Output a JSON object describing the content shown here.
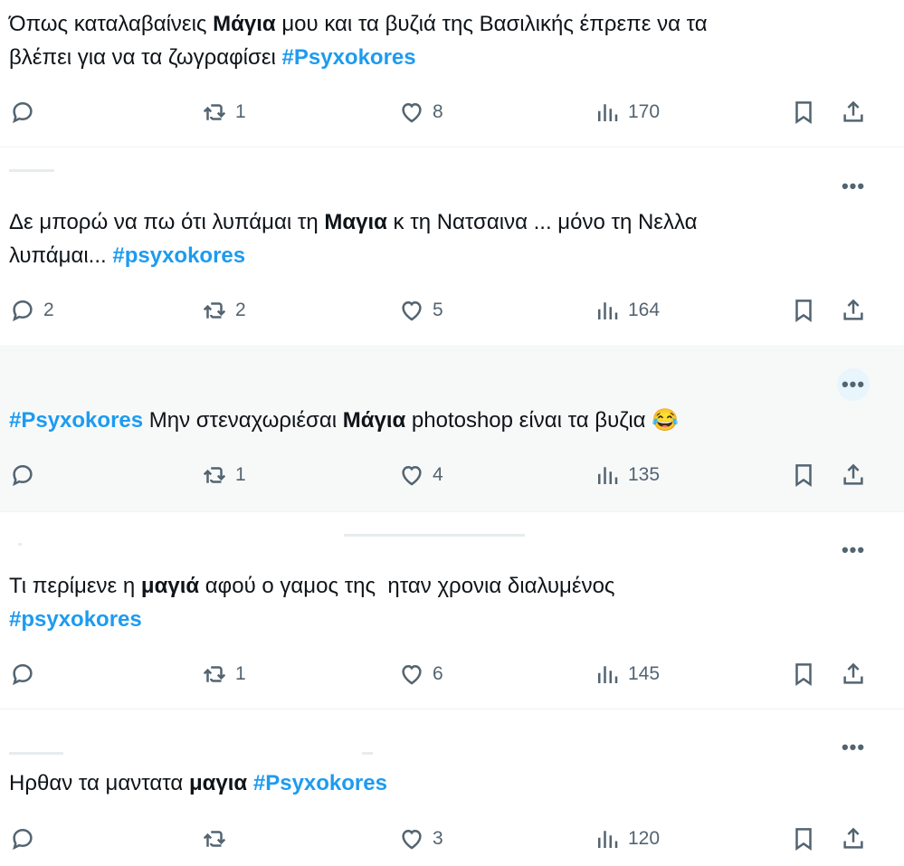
{
  "tweets": [
    {
      "text": [
        {
          "t": "Όπως καταλαβαίνεις ",
          "s": "n"
        },
        {
          "t": "Μάγια",
          "s": "b"
        },
        {
          "t": " μου και τα βυζιά της Βασιλικής έπρεπε να τα\nβλέπει για να τα ζωγραφίσει ",
          "s": "n"
        },
        {
          "t": "#Psyxokores",
          "s": "tag"
        }
      ],
      "replies": "",
      "retweets": "1",
      "likes": "8",
      "views": "170"
    },
    {
      "text": [
        {
          "t": "Δε μπορώ να πω ότι λυπάμαι τη ",
          "s": "n"
        },
        {
          "t": "Μαγια",
          "s": "b"
        },
        {
          "t": " κ τη Νατσαινα ... μόνο τη Νελλα\nλυπάμαι... ",
          "s": "n"
        },
        {
          "t": "#psyxokores",
          "s": "tag"
        }
      ],
      "replies": "2",
      "retweets": "2",
      "likes": "5",
      "views": "164"
    },
    {
      "text": [
        {
          "t": "#Psyxokores",
          "s": "tag"
        },
        {
          "t": " Μην στεναχωριέσαι ",
          "s": "n"
        },
        {
          "t": "Μάγια",
          "s": "b"
        },
        {
          "t": " photoshop είναι τα βυζια 😂",
          "s": "n"
        }
      ],
      "replies": "",
      "retweets": "1",
      "likes": "4",
      "views": "135"
    },
    {
      "text": [
        {
          "t": "Τι περίμενε η ",
          "s": "n"
        },
        {
          "t": "μαγιά",
          "s": "b"
        },
        {
          "t": " αφού ο γαμος της  ηταν χρονια διαλυμένος\n",
          "s": "n"
        },
        {
          "t": "#psyxokores",
          "s": "tag"
        }
      ],
      "replies": "",
      "retweets": "1",
      "likes": "6",
      "views": "145"
    },
    {
      "text": [
        {
          "t": "Ηρθαν τα μαντατα ",
          "s": "n"
        },
        {
          "t": "μαγια",
          "s": "b"
        },
        {
          "t": " ",
          "s": "n"
        },
        {
          "t": "#Psyxokores",
          "s": "tag"
        }
      ],
      "replies": "",
      "retweets": "",
      "likes": "3",
      "views": "120"
    }
  ],
  "more_label": "•••",
  "icons": {
    "reply": "reply-icon",
    "retweet": "retweet-icon",
    "like": "heart-icon",
    "views": "views-chart-icon",
    "bookmark": "bookmark-icon",
    "share": "share-icon"
  },
  "colors": {
    "hashtag": "#1d9bf0",
    "muted": "#536471",
    "hover_bg": "#f7f9f9"
  }
}
